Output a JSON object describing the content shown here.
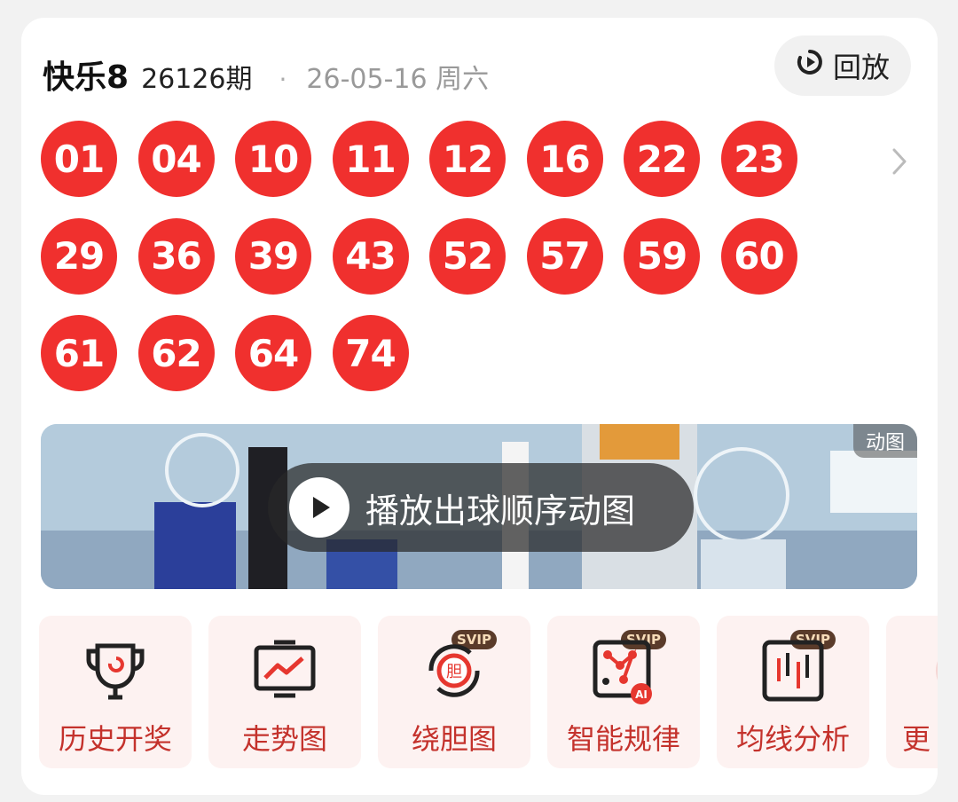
{
  "header": {
    "title": "快乐8",
    "issue": "26126期",
    "separator": "·",
    "date": "26-05-16 周六",
    "replay_label": "回放"
  },
  "balls": [
    "01",
    "04",
    "10",
    "11",
    "12",
    "16",
    "22",
    "23",
    "29",
    "36",
    "39",
    "43",
    "52",
    "57",
    "59",
    "60",
    "61",
    "62",
    "64",
    "74"
  ],
  "video": {
    "tag": "动图",
    "play_label": "播放出球顺序动图"
  },
  "tools": [
    {
      "label": "历史开奖",
      "icon": "trophy-icon",
      "badge": ""
    },
    {
      "label": "走势图",
      "icon": "trend-chart-icon",
      "badge": ""
    },
    {
      "label": "绕胆图",
      "icon": "cycle-dan-icon",
      "badge": "SVIP"
    },
    {
      "label": "智能规律",
      "icon": "ai-dots-icon",
      "badge": "SVIP"
    },
    {
      "label": "均线分析",
      "icon": "candlestick-icon",
      "badge": "SVIP"
    },
    {
      "label": "更",
      "icon": "more-icon",
      "badge": ""
    }
  ],
  "colors": {
    "ball": "#f0302e",
    "accent": "#c4322c",
    "tool_bg": "#fdf2f1"
  }
}
